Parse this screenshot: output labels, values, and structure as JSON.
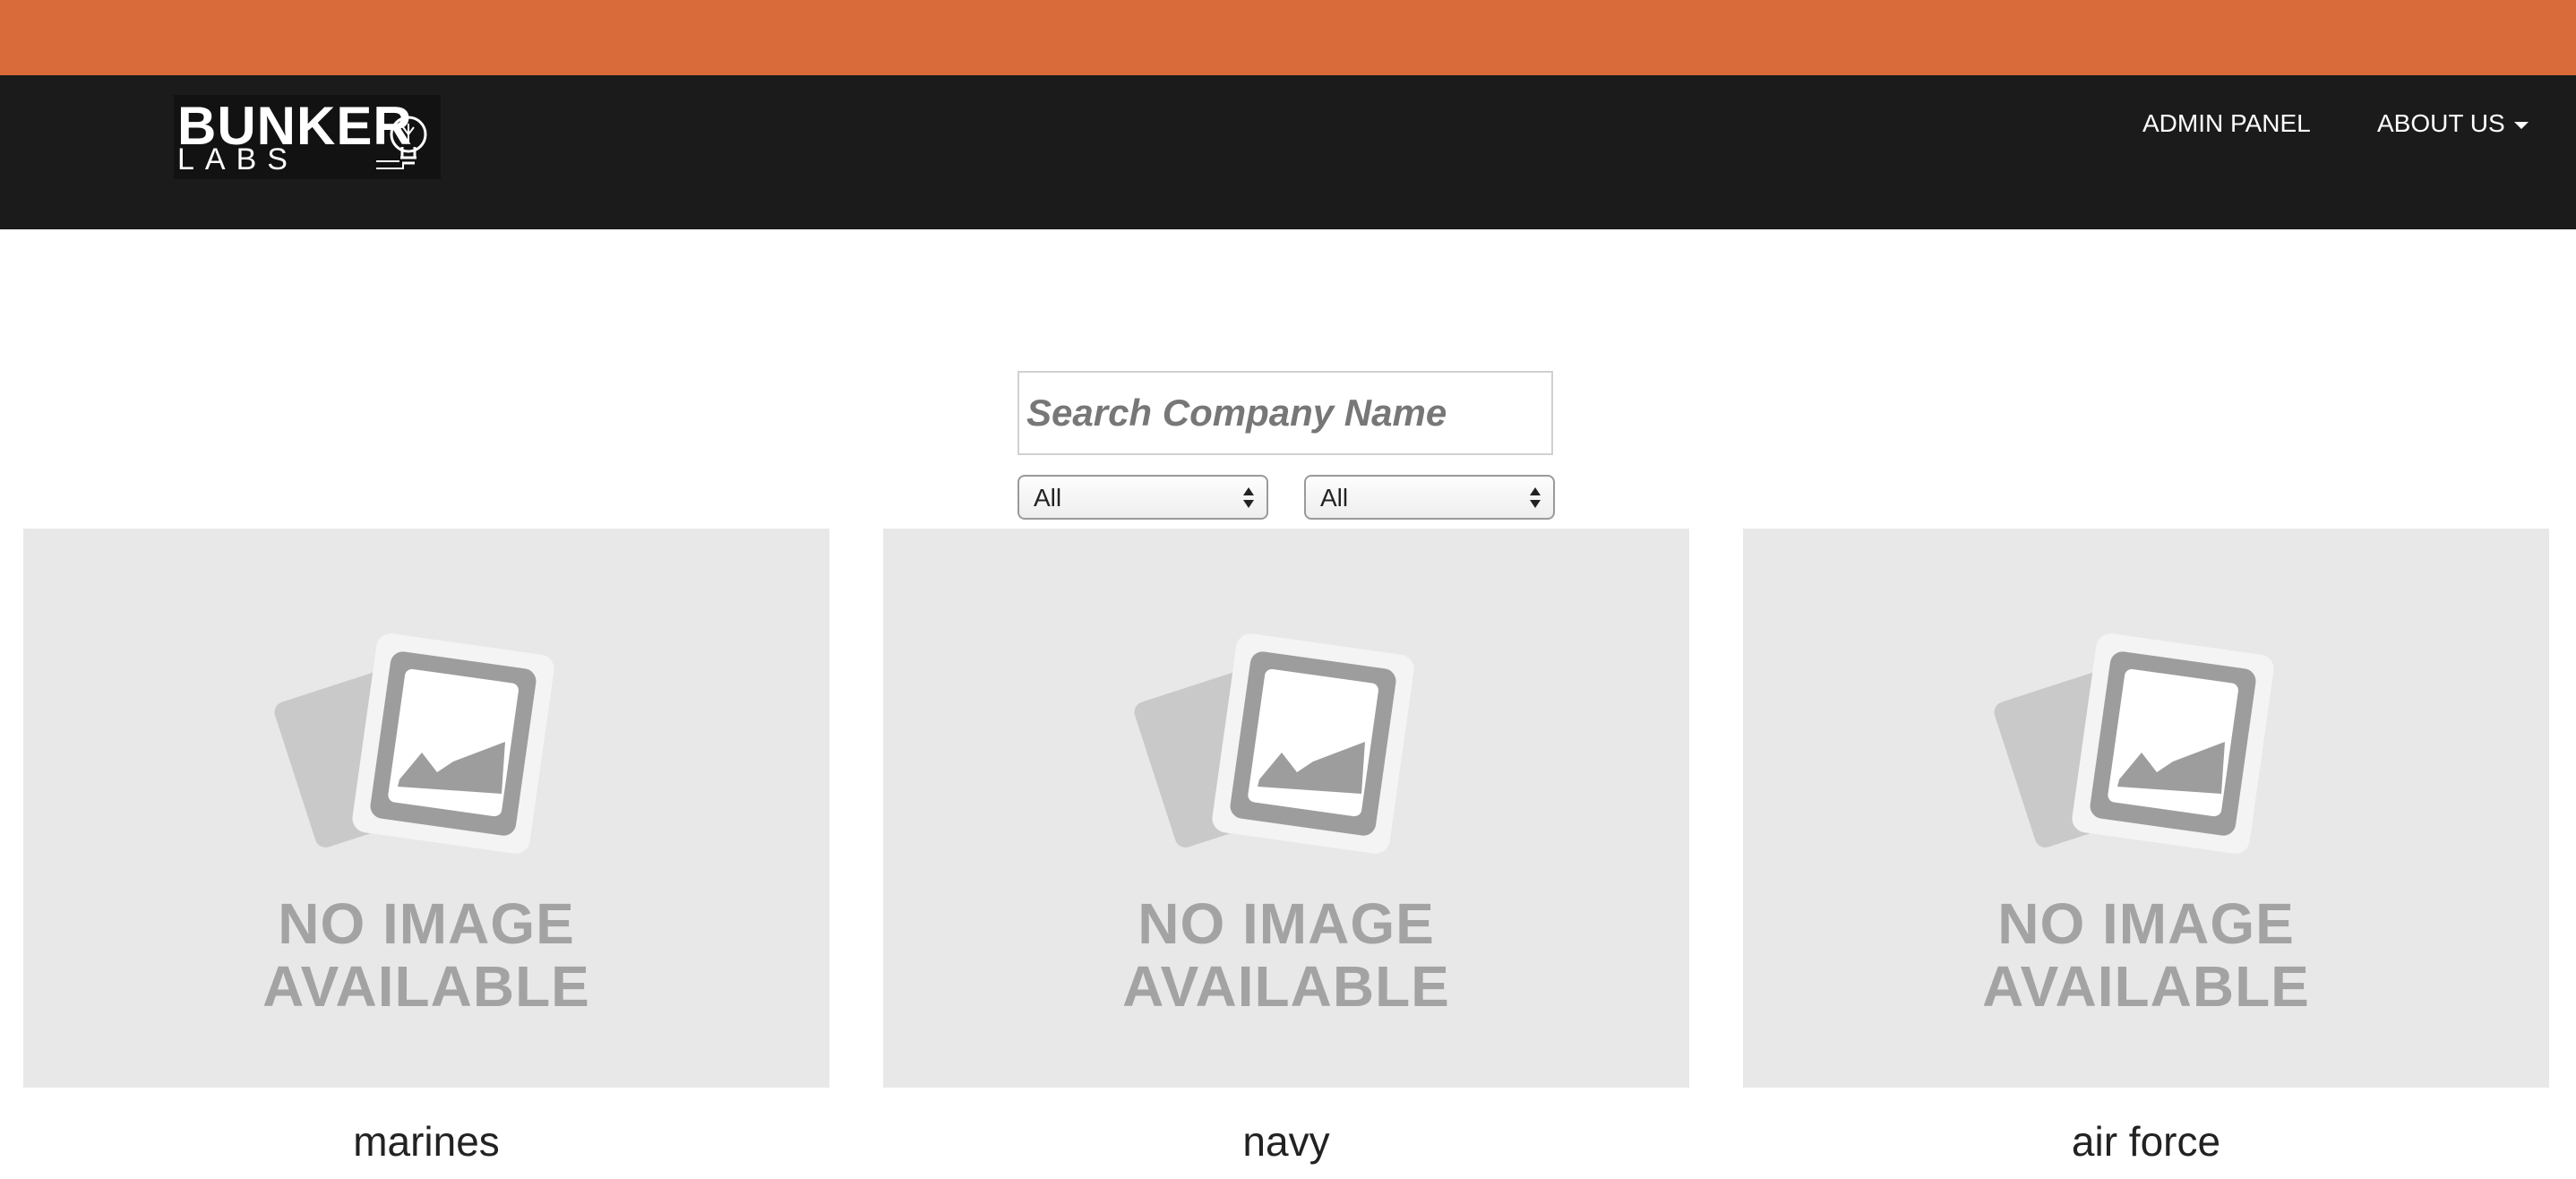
{
  "colors": {
    "accent_stripe": "#d96a3a",
    "navbar_bg": "#1b1b1b",
    "card_bg": "#e8e8e8"
  },
  "header": {
    "logo": {
      "line1": "BUNKER",
      "line2": "LABS",
      "icon": "lightbulb-icon"
    },
    "nav": {
      "admin_panel": "ADMIN PANEL",
      "about_us": "ABOUT US",
      "about_us_icon": "caret-down-icon"
    }
  },
  "filters": {
    "search_placeholder": "Search Company Name",
    "search_value": "",
    "select_1_value": "All",
    "select_2_value": "All"
  },
  "cards": [
    {
      "image_line1": "NO IMAGE",
      "image_line2": "AVAILABLE",
      "name": "marines"
    },
    {
      "image_line1": "NO IMAGE",
      "image_line2": "AVAILABLE",
      "name": "navy"
    },
    {
      "image_line1": "NO IMAGE",
      "image_line2": "AVAILABLE",
      "name": "air force"
    }
  ]
}
